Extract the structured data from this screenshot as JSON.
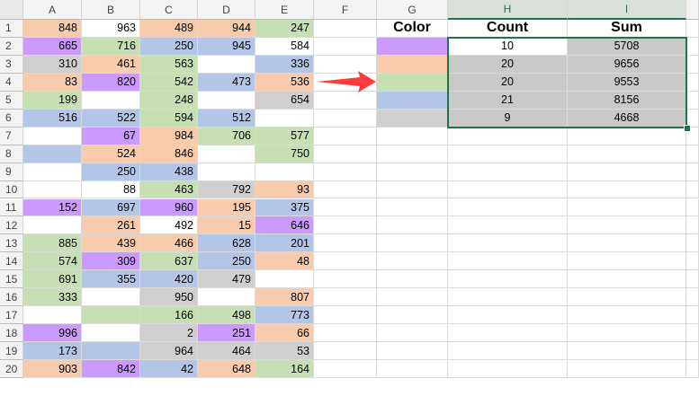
{
  "spreadsheet": {
    "columns": [
      "A",
      "B",
      "C",
      "D",
      "E",
      "F",
      "G",
      "H",
      "I"
    ],
    "selected_columns": [
      "H",
      "I"
    ],
    "rows": [
      "1",
      "2",
      "3",
      "4",
      "5",
      "6",
      "7",
      "8",
      "9",
      "10",
      "11",
      "12",
      "13",
      "14",
      "15",
      "16",
      "17",
      "18",
      "19",
      "20"
    ],
    "palette": {
      "orange": "#f8cbad",
      "purple": "#cc99ff",
      "green": "#c6e0b4",
      "blue": "#b4c6e7",
      "gray": "#d0cece",
      "white": "#ffffff",
      "dark_gray": "#c9c9c9",
      "selection": "#217346",
      "arrow": "#ff3b3b"
    },
    "cells": [
      [
        {
          "v": "848",
          "c": "orange"
        },
        {
          "v": "963",
          "c": "white"
        },
        {
          "v": "489",
          "c": "orange"
        },
        {
          "v": "944",
          "c": "orange"
        },
        {
          "v": "247",
          "c": "green"
        }
      ],
      [
        {
          "v": "665",
          "c": "purple"
        },
        {
          "v": "716",
          "c": "green"
        },
        {
          "v": "250",
          "c": "blue"
        },
        {
          "v": "945",
          "c": "blue"
        },
        {
          "v": "584",
          "c": "white"
        }
      ],
      [
        {
          "v": "310",
          "c": "gray"
        },
        {
          "v": "461",
          "c": "orange"
        },
        {
          "v": "563",
          "c": "green"
        },
        {
          "v": "",
          "c": "white"
        },
        {
          "v": "336",
          "c": "blue"
        }
      ],
      [
        {
          "v": "83",
          "c": "orange"
        },
        {
          "v": "820",
          "c": "purple"
        },
        {
          "v": "542",
          "c": "green"
        },
        {
          "v": "473",
          "c": "blue"
        },
        {
          "v": "536",
          "c": "orange"
        }
      ],
      [
        {
          "v": "199",
          "c": "green"
        },
        {
          "v": "",
          "c": "white"
        },
        {
          "v": "248",
          "c": "green"
        },
        {
          "v": "",
          "c": "white"
        },
        {
          "v": "654",
          "c": "gray"
        }
      ],
      [
        {
          "v": "516",
          "c": "blue"
        },
        {
          "v": "522",
          "c": "blue"
        },
        {
          "v": "594",
          "c": "green"
        },
        {
          "v": "512",
          "c": "blue"
        },
        {
          "v": "",
          "c": "white"
        }
      ],
      [
        {
          "v": "",
          "c": "white"
        },
        {
          "v": "67",
          "c": "purple"
        },
        {
          "v": "984",
          "c": "orange"
        },
        {
          "v": "706",
          "c": "green"
        },
        {
          "v": "577",
          "c": "green"
        }
      ],
      [
        {
          "v": "",
          "c": "blue"
        },
        {
          "v": "524",
          "c": "orange"
        },
        {
          "v": "846",
          "c": "orange"
        },
        {
          "v": "",
          "c": "white"
        },
        {
          "v": "750",
          "c": "green"
        }
      ],
      [
        {
          "v": "",
          "c": "white"
        },
        {
          "v": "250",
          "c": "blue"
        },
        {
          "v": "438",
          "c": "blue"
        },
        {
          "v": "",
          "c": "white"
        },
        {
          "v": "",
          "c": "white"
        }
      ],
      [
        {
          "v": "",
          "c": "white"
        },
        {
          "v": "88",
          "c": "white"
        },
        {
          "v": "463",
          "c": "green"
        },
        {
          "v": "792",
          "c": "gray"
        },
        {
          "v": "93",
          "c": "orange"
        }
      ],
      [
        {
          "v": "152",
          "c": "purple"
        },
        {
          "v": "697",
          "c": "blue"
        },
        {
          "v": "960",
          "c": "purple"
        },
        {
          "v": "195",
          "c": "orange"
        },
        {
          "v": "375",
          "c": "blue"
        }
      ],
      [
        {
          "v": "",
          "c": "white"
        },
        {
          "v": "261",
          "c": "orange"
        },
        {
          "v": "492",
          "c": "white"
        },
        {
          "v": "15",
          "c": "orange"
        },
        {
          "v": "646",
          "c": "purple"
        }
      ],
      [
        {
          "v": "885",
          "c": "green"
        },
        {
          "v": "439",
          "c": "orange"
        },
        {
          "v": "466",
          "c": "orange"
        },
        {
          "v": "628",
          "c": "blue"
        },
        {
          "v": "201",
          "c": "blue"
        }
      ],
      [
        {
          "v": "574",
          "c": "green"
        },
        {
          "v": "309",
          "c": "purple"
        },
        {
          "v": "637",
          "c": "green"
        },
        {
          "v": "250",
          "c": "blue"
        },
        {
          "v": "48",
          "c": "orange"
        }
      ],
      [
        {
          "v": "691",
          "c": "green"
        },
        {
          "v": "355",
          "c": "blue"
        },
        {
          "v": "420",
          "c": "blue"
        },
        {
          "v": "479",
          "c": "gray"
        },
        {
          "v": "",
          "c": "white"
        }
      ],
      [
        {
          "v": "333",
          "c": "green"
        },
        {
          "v": "",
          "c": "white"
        },
        {
          "v": "950",
          "c": "gray"
        },
        {
          "v": "",
          "c": "white"
        },
        {
          "v": "807",
          "c": "orange"
        }
      ],
      [
        {
          "v": "",
          "c": "white"
        },
        {
          "v": "",
          "c": "green"
        },
        {
          "v": "166",
          "c": "green"
        },
        {
          "v": "498",
          "c": "green"
        },
        {
          "v": "773",
          "c": "blue"
        }
      ],
      [
        {
          "v": "996",
          "c": "purple"
        },
        {
          "v": "",
          "c": "white"
        },
        {
          "v": "2",
          "c": "gray"
        },
        {
          "v": "251",
          "c": "purple"
        },
        {
          "v": "66",
          "c": "orange"
        }
      ],
      [
        {
          "v": "173",
          "c": "blue"
        },
        {
          "v": "",
          "c": "blue"
        },
        {
          "v": "964",
          "c": "gray"
        },
        {
          "v": "464",
          "c": "gray"
        },
        {
          "v": "53",
          "c": "gray"
        }
      ],
      [
        {
          "v": "903",
          "c": "orange"
        },
        {
          "v": "842",
          "c": "purple"
        },
        {
          "v": "42",
          "c": "blue"
        },
        {
          "v": "648",
          "c": "orange"
        },
        {
          "v": "164",
          "c": "green"
        }
      ]
    ],
    "summary": {
      "headers": [
        "Color",
        "Count",
        "Sum"
      ],
      "rows": [
        {
          "color": "purple",
          "count": "10",
          "sum": "5708",
          "count_bg": "white"
        },
        {
          "color": "orange",
          "count": "20",
          "sum": "9656",
          "count_bg": "dark_gray"
        },
        {
          "color": "green",
          "count": "20",
          "sum": "9553",
          "count_bg": "dark_gray"
        },
        {
          "color": "blue",
          "count": "21",
          "sum": "8156",
          "count_bg": "dark_gray"
        },
        {
          "color": "gray",
          "count": "9",
          "sum": "4668",
          "count_bg": "dark_gray"
        }
      ]
    }
  }
}
